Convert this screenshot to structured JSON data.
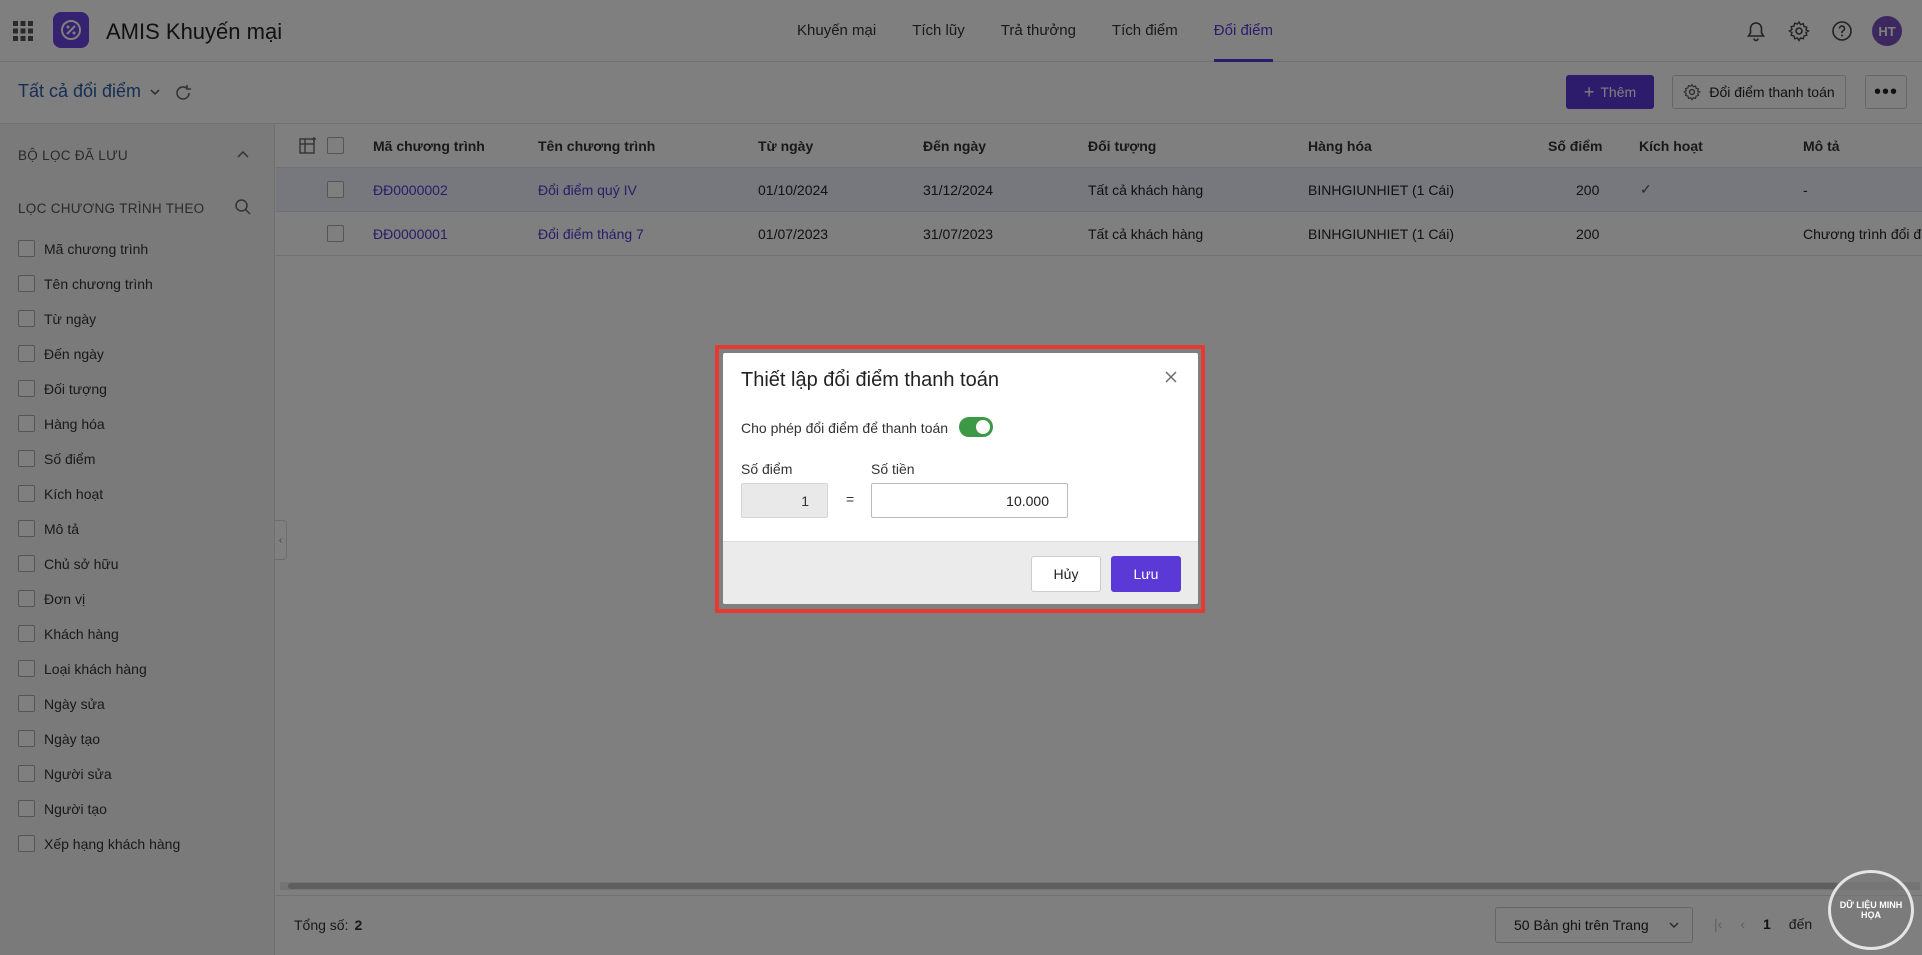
{
  "app": {
    "title": "AMIS Khuyến mại"
  },
  "nav": [
    {
      "label": "Khuyến mại",
      "active": false
    },
    {
      "label": "Tích lũy",
      "active": false
    },
    {
      "label": "Trả thưởng",
      "active": false
    },
    {
      "label": "Tích điểm",
      "active": false
    },
    {
      "label": "Đổi điểm",
      "active": true
    }
  ],
  "user": {
    "initials": "HT"
  },
  "toolbar": {
    "view_title": "Tất cả đổi điểm",
    "add_label": "Thêm",
    "settings_label": "Đổi điểm thanh toán"
  },
  "sidebar": {
    "saved_filter_title": "BỘ LỌC ĐÃ LƯU",
    "filter_by_title": "LỌC CHƯƠNG TRÌNH THEO",
    "items": [
      "Mã chương trình",
      "Tên chương trình",
      "Từ ngày",
      "Đến ngày",
      "Đối tượng",
      "Hàng hóa",
      "Số điểm",
      "Kích hoạt",
      "Mô tả",
      "Chủ sở hữu",
      "Đơn vị",
      "Khách hàng",
      "Loại khách hàng",
      "Ngày sửa",
      "Ngày tạo",
      "Người sửa",
      "Người tạo",
      "Xếp hạng khách hàng"
    ]
  },
  "table": {
    "headers": {
      "code": "Mã chương trình",
      "name": "Tên chương trình",
      "from": "Từ ngày",
      "to": "Đến ngày",
      "target": "Đối tượng",
      "goods": "Hàng hóa",
      "points": "Số điểm",
      "active": "Kích hoạt",
      "desc": "Mô tả"
    },
    "rows": [
      {
        "code": "ĐĐ0000002",
        "name": "Đổi điểm quý IV",
        "from": "01/10/2024",
        "to": "31/12/2024",
        "target": "Tất cả khách hàng",
        "goods": "BINHGIUNHIET (1 Cái)",
        "points": "200",
        "active": "✓",
        "desc": "-"
      },
      {
        "code": "ĐĐ0000001",
        "name": "Đổi điểm tháng 7",
        "from": "01/07/2023",
        "to": "31/07/2023",
        "target": "Tất cả khách hàng",
        "goods": "BINHGIUNHIET (1 Cái)",
        "points": "200",
        "active": "",
        "desc": "Chương trình đổi đ"
      }
    ]
  },
  "footer": {
    "total_label": "Tổng số:",
    "total_value": "2",
    "page_size": "50 Bản ghi trên Trang",
    "current_page": "1",
    "to_label": "đến"
  },
  "dialog": {
    "title": "Thiết lập đổi điểm thanh toán",
    "allow_label": "Cho phép đổi điểm để thanh toán",
    "allow_enabled": true,
    "points_label": "Số điểm",
    "points_value": "1",
    "equals": "=",
    "money_label": "Số tiền",
    "money_value": "10.000",
    "cancel_label": "Hủy",
    "save_label": "Lưu"
  },
  "watermark": {
    "text": "DỮ LIỆU MINH HỌA"
  },
  "colors": {
    "accent": "#5b39d6",
    "highlight": "#e53935",
    "toggle_on": "#3c9a46"
  }
}
